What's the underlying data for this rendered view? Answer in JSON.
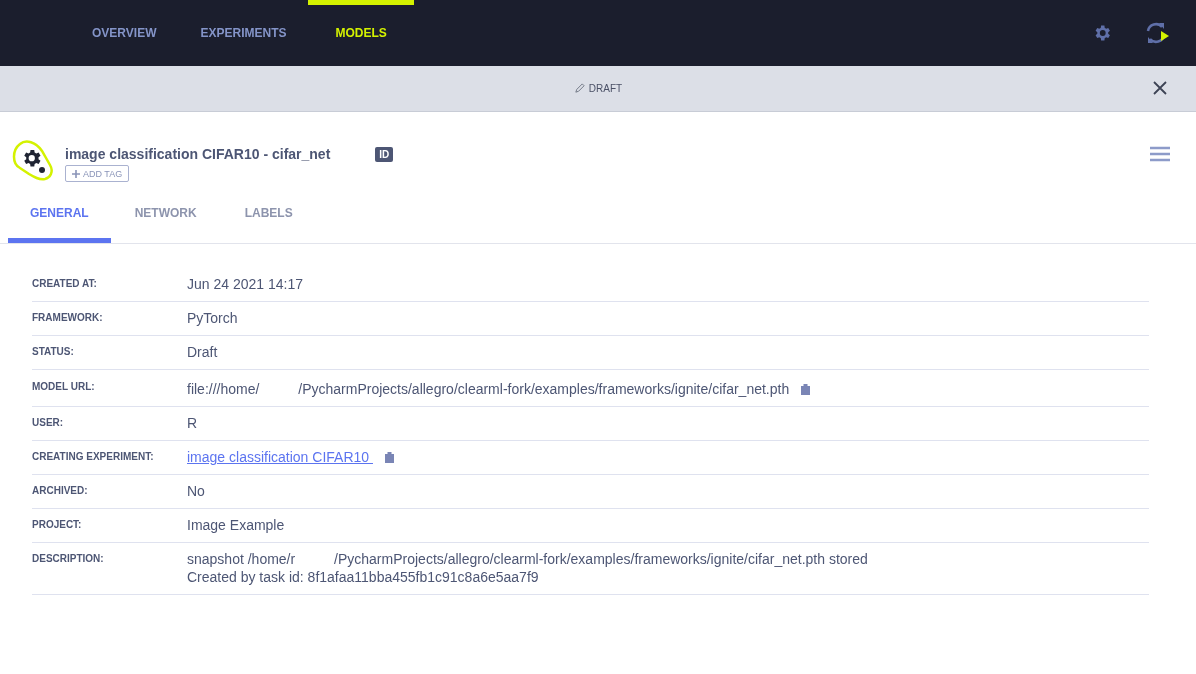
{
  "nav": {
    "tabs": [
      {
        "label": "OVERVIEW",
        "selected": false
      },
      {
        "label": "EXPERIMENTS",
        "selected": false
      },
      {
        "label": "MODELS",
        "selected": true
      }
    ]
  },
  "banner": {
    "label": "DRAFT"
  },
  "model": {
    "title": "image classification CIFAR10 - cifar_net",
    "id_badge": "ID",
    "add_tag": "ADD TAG"
  },
  "tabs": [
    {
      "label": "GENERAL",
      "selected": true
    },
    {
      "label": "NETWORK",
      "selected": false
    },
    {
      "label": "LABELS",
      "selected": false
    }
  ],
  "fields": [
    {
      "label": "CREATED AT:",
      "kind": "text",
      "lines": [
        "Jun 24 2021 14:17"
      ],
      "copyable": false
    },
    {
      "label": "FRAMEWORK:",
      "kind": "text",
      "lines": [
        "PyTorch"
      ],
      "copyable": false
    },
    {
      "label": "STATUS:",
      "kind": "text",
      "lines": [
        "Draft"
      ],
      "copyable": false
    },
    {
      "label": "MODEL URL:",
      "kind": "text",
      "lines": [
        "file:///home/          /PycharmProjects/allegro/clearml-fork/examples/frameworks/ignite/cifar_net.pth"
      ],
      "copyable": true
    },
    {
      "label": "USER:",
      "kind": "text",
      "lines": [
        "R"
      ],
      "copyable": false
    },
    {
      "label": "CREATING EXPERIMENT:",
      "kind": "link",
      "lines": [
        "image classification CIFAR10 "
      ],
      "copyable": true
    },
    {
      "label": "ARCHIVED:",
      "kind": "text",
      "lines": [
        "No"
      ],
      "copyable": false
    },
    {
      "label": "PROJECT:",
      "kind": "text",
      "lines": [
        "Image Example"
      ],
      "copyable": false
    },
    {
      "label": "DESCRIPTION:",
      "kind": "text",
      "lines": [
        "snapshot /home/r          /PycharmProjects/allegro/clearml-fork/examples/frameworks/ignite/cifar_net.pth stored",
        "Created by task id: 8f1afaa11bba455fb1c91c8a6e5aa7f9"
      ],
      "copyable": false
    }
  ]
}
